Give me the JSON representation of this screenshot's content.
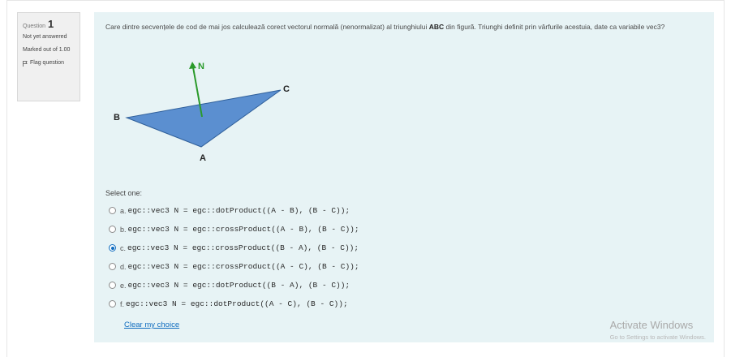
{
  "question_info": {
    "label": "Question",
    "number": "1",
    "state": "Not yet answered",
    "grade": "Marked out of 1.00",
    "flag_label": "Flag question",
    "flag_icon": "flag-icon"
  },
  "question": {
    "text_part1": "Care dintre secvențele de cod de mai jos calculează corect vectorul normală (nenormalizat) al triunghiului ",
    "text_bold": "ABC",
    "text_part2": " din figură. Triunghi definit prin vârfurile acestuia, date ca variabile vec3?",
    "figure": {
      "label_N": "N",
      "label_C": "C",
      "label_B": "B",
      "label_A": "A",
      "triangle_color": "#5b8fd0",
      "normal_color": "#2a9a2a"
    },
    "prompt": "Select one:",
    "options": [
      {
        "letter": "a.",
        "code": "egc::vec3 N = egc::dotProduct((A - B), (B - C));",
        "checked": false
      },
      {
        "letter": "b.",
        "code": "egc::vec3 N = egc::crossProduct((A - B), (B - C));",
        "checked": false
      },
      {
        "letter": "c.",
        "code": "egc::vec3 N = egc::crossProduct((B - A), (B - C));",
        "checked": true
      },
      {
        "letter": "d.",
        "code": "egc::vec3 N = egc::crossProduct((A - C), (B - C));",
        "checked": false
      },
      {
        "letter": "e.",
        "code": "egc::vec3 N = egc::dotProduct((B - A), (B - C));",
        "checked": false
      },
      {
        "letter": "f.",
        "code": "egc::vec3 N = egc::dotProduct((A - C), (B - C));",
        "checked": false
      }
    ],
    "clear_label": "Clear my choice"
  },
  "watermark": {
    "title": "Activate Windows",
    "subtitle": "Go to Settings to activate Windows."
  },
  "colors": {
    "accent": "#0f6cbf",
    "content_bg": "#e7f3f5",
    "info_bg": "#f0f0f0"
  }
}
